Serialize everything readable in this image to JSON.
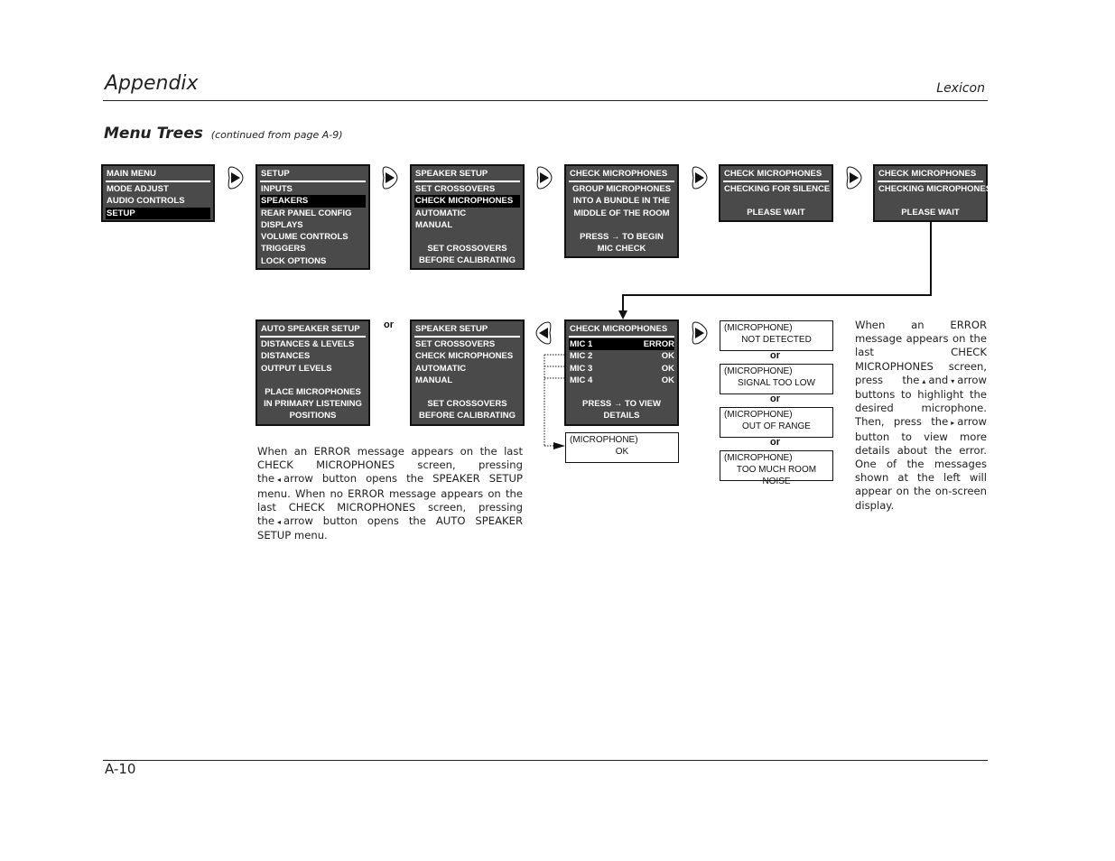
{
  "header": {
    "title": "Appendix",
    "brand": "Lexicon"
  },
  "section": {
    "title": "Menu Trees",
    "subtitle": "(continued from page A-9)"
  },
  "footer": {
    "page_number": "A-10"
  },
  "nav_buttons": {
    "right_arrow": "right-arrow-button",
    "left_arrow": "left-arrow-button"
  },
  "screens": {
    "main_menu": {
      "title": "MAIN MENU",
      "items": [
        "MODE ADJUST",
        "AUDIO CONTROLS",
        "SETUP"
      ],
      "selected": "SETUP"
    },
    "setup": {
      "title": "SETUP",
      "items": [
        "INPUTS",
        "SPEAKERS",
        "REAR PANEL CONFIG",
        "DISPLAYS",
        "VOLUME CONTROLS",
        "TRIGGERS",
        "LOCK OPTIONS"
      ],
      "selected": "SPEAKERS"
    },
    "speaker_setup_1": {
      "title": "SPEAKER SETUP",
      "items": [
        "SET CROSSOVERS",
        "CHECK MICROPHONES",
        "AUTOMATIC",
        "MANUAL"
      ],
      "selected": "CHECK MICROPHONES",
      "note": [
        "SET CROSSOVERS",
        "BEFORE CALIBRATING"
      ]
    },
    "check_mics_1": {
      "title": "CHECK MICROPHONES",
      "lines": [
        "GROUP MICROPHONES",
        "INTO A BUNDLE IN THE",
        "MIDDLE OF THE ROOM"
      ],
      "note": [
        "PRESS → TO BEGIN",
        "MIC CHECK"
      ]
    },
    "check_mics_2": {
      "title": "CHECK MICROPHONES",
      "status": "CHECKING FOR SILENCE",
      "note": "PLEASE WAIT"
    },
    "check_mics_3": {
      "title": "CHECK MICROPHONES",
      "status": "CHECKING MICROPHONES",
      "note": "PLEASE WAIT"
    },
    "auto_speaker_setup": {
      "title": "AUTO SPEAKER SETUP",
      "items": [
        "DISTANCES & LEVELS",
        "DISTANCES",
        "OUTPUT LEVELS"
      ],
      "note": [
        "PLACE MICROPHONES",
        "IN PRIMARY LISTENING",
        "POSITIONS"
      ]
    },
    "speaker_setup_2": {
      "title": "SPEAKER SETUP",
      "items": [
        "SET CROSSOVERS",
        "CHECK MICROPHONES",
        "AUTOMATIC",
        "MANUAL"
      ],
      "note": [
        "SET CROSSOVERS",
        "BEFORE CALIBRATING"
      ]
    },
    "check_mics_result": {
      "title": "CHECK MICROPHONES",
      "mics": [
        {
          "name": "MIC 1",
          "status": "ERROR"
        },
        {
          "name": "MIC 2",
          "status": "OK"
        },
        {
          "name": "MIC 3",
          "status": "OK"
        },
        {
          "name": "MIC 4",
          "status": "OK"
        }
      ],
      "selected": "MIC 1",
      "note": [
        "PRESS → TO VIEW",
        "DETAILS"
      ]
    }
  },
  "or_label": "or",
  "mic_ok_message": {
    "line1": "(MICROPHONE)",
    "line2": "OK"
  },
  "error_messages": [
    {
      "line1": "(MICROPHONE)",
      "line2": "NOT DETECTED"
    },
    {
      "line1": "(MICROPHONE)",
      "line2": "SIGNAL TOO LOW"
    },
    {
      "line1": "(MICROPHONE)",
      "line2": "OUT OF RANGE"
    },
    {
      "line1": "(MICROPHONE)",
      "line2": "TOO MUCH ROOM NOISE"
    }
  ],
  "paragraphs": {
    "left_note": {
      "p1": "When an ERROR message appears on the last CHECK MICROPHONES screen, pressing the",
      "p2": "arrow button opens the SPEAKER SETUP menu. When no ERROR message appears on the last CHECK MICROPHONES screen, pressing the",
      "p3": "arrow button opens the AUTO SPEAKER SETUP menu.",
      "glyph": "◂"
    },
    "right_note": {
      "p1": "When an ERROR message appears on the last CHECK MICROPHONES screen, press the",
      "p2": "and",
      "p3": "arrow buttons to highlight the desired microphone. Then, press the",
      "p4": "arrow button to view more details about the error. One of the messages shown at the left will appear on the on-screen display.",
      "up_glyph": "▴",
      "down_glyph": "▾",
      "right_glyph": "▸"
    }
  }
}
